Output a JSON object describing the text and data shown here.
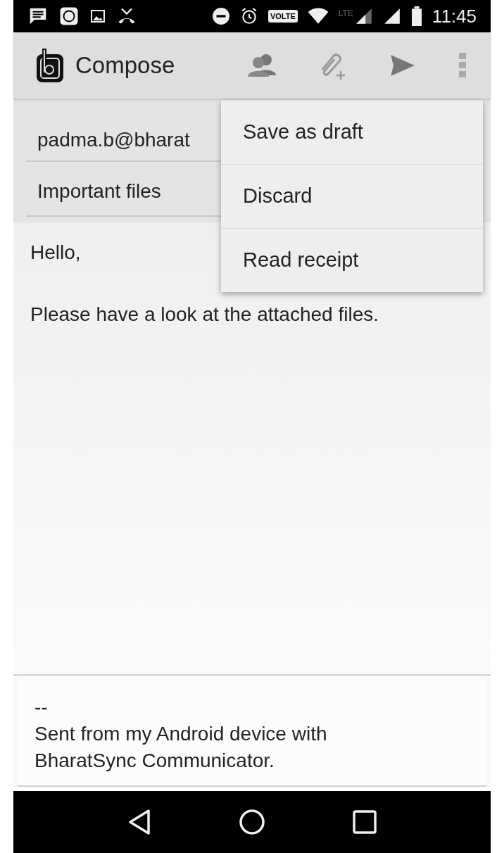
{
  "status_bar": {
    "volte": "VOLTE",
    "network": "LTE",
    "time": "11:45"
  },
  "app_bar": {
    "title": "Compose"
  },
  "to_field": {
    "value": "padma.b@bharat"
  },
  "subject_field": {
    "value": "Important files"
  },
  "body": [
    "Hello,",
    "Please have a look at the attached files."
  ],
  "signature": [
    "--",
    "Sent from my Android device with",
    "BharatSync Communicator."
  ],
  "menu": [
    {
      "label": "Save as draft"
    },
    {
      "label": "Discard"
    },
    {
      "label": "Read receipt"
    }
  ]
}
